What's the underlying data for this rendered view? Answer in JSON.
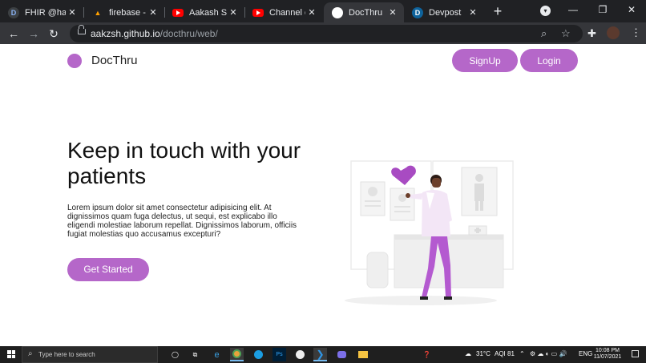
{
  "browser": {
    "tabs": [
      {
        "title": "FHIR @hac",
        "favicon": "devpost-d-icon"
      },
      {
        "title": "firebase - H",
        "favicon": "firebase-icon"
      },
      {
        "title": "Aakash Shr",
        "favicon": "youtube-icon"
      },
      {
        "title": "Channel co",
        "favicon": "youtube-icon"
      },
      {
        "title": "DocThru",
        "favicon": "github-icon",
        "active": true
      },
      {
        "title": "Devpost",
        "favicon": "devpost-d-icon"
      }
    ],
    "url_host": "aakzsh.github.io",
    "url_path": "/docthru/web/"
  },
  "site": {
    "brand": "DocThru",
    "signup_label": "SignUp",
    "login_label": "Login",
    "accent_color": "#b567c9",
    "hero_title": "Keep in touch with your patients",
    "hero_text": "Lorem ipsum dolor sit amet consectetur adipisicing elit. At dignissimos quam fuga delectus, ut sequi, est explicabo illo eligendi molestiae laborum repellat. Dignissimos laborum, officiis fugiat molestias quo accusamus excepturi?",
    "cta_label": "Get Started"
  },
  "taskbar": {
    "search_placeholder": "Type here to search",
    "weather": "31°C",
    "aqi": "AQI 81",
    "language": "ENG",
    "time": "10:08 PM",
    "date": "11/07/2021"
  }
}
